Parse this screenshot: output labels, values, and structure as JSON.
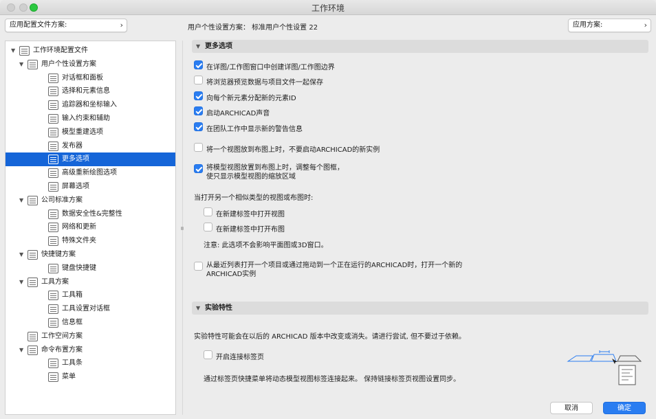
{
  "window": {
    "title": "工作环境"
  },
  "topbar": {
    "profile_select": "应用配置文件方案:",
    "user_scheme": "用户个性设置方案：  标准用户个性设置 22",
    "apply_scheme": "应用方案:"
  },
  "tree": [
    {
      "label": "工作环境配置文件",
      "icon": "monitor-icon",
      "level": 0,
      "expanded": true
    },
    {
      "label": "用户个性设置方案",
      "icon": "user-prefs-icon",
      "level": 1,
      "expanded": true
    },
    {
      "label": "对话框和面板",
      "icon": "dialog-icon",
      "level": 2
    },
    {
      "label": "选择和元素信息",
      "icon": "selection-icon",
      "level": 2
    },
    {
      "label": "追踪器和坐标输入",
      "icon": "xyz-tracker-icon",
      "level": 2
    },
    {
      "label": "输入约束和辅助",
      "icon": "pointer-icon",
      "level": 2
    },
    {
      "label": "模型重建选项",
      "icon": "model-icon",
      "level": 2
    },
    {
      "label": "发布器",
      "icon": "publisher-icon",
      "level": 2
    },
    {
      "label": "更多选项",
      "icon": "more-options-icon",
      "level": 2,
      "selected": true
    },
    {
      "label": "高级重新绘图选项",
      "icon": "redraw-icon",
      "level": 2
    },
    {
      "label": "屏幕选项",
      "icon": "screen-icon",
      "level": 2
    },
    {
      "label": "公司标准方案",
      "icon": "company-icon",
      "level": 1,
      "expanded": true
    },
    {
      "label": "数据安全性&完整性",
      "icon": "data-safety-icon",
      "level": 2
    },
    {
      "label": "网络和更新",
      "icon": "globe-icon",
      "level": 2
    },
    {
      "label": "特殊文件夹",
      "icon": "folder-icon",
      "level": 2
    },
    {
      "label": "快捷键方案",
      "icon": "shortcut-icon",
      "level": 1,
      "expanded": true
    },
    {
      "label": "键盘快捷键",
      "icon": "keyboard-icon",
      "level": 2
    },
    {
      "label": "工具方案",
      "icon": "tools-icon",
      "level": 1,
      "expanded": true
    },
    {
      "label": "工具箱",
      "icon": "toolbox-icon",
      "level": 2
    },
    {
      "label": "工具设置对话框",
      "icon": "tool-settings-icon",
      "level": 2
    },
    {
      "label": "信息框",
      "icon": "info-box-icon",
      "level": 2
    },
    {
      "label": "工作空间方案",
      "icon": "workspace-icon",
      "level": 1
    },
    {
      "label": "命令布置方案",
      "icon": "command-icon",
      "level": 1,
      "expanded": true
    },
    {
      "label": "工具条",
      "icon": "toolbar-icon",
      "level": 2
    },
    {
      "label": "菜单",
      "icon": "menu-icon",
      "level": 2
    }
  ],
  "more_options": {
    "header": "更多选项",
    "opt1": {
      "label": "在详图/工作图窗口中创建详图/工作图边界",
      "checked": true
    },
    "opt2": {
      "label": "将浏览器预览数据与项目文件一起保存",
      "checked": false
    },
    "opt3": {
      "label": "向每个新元素分配新的元素ID",
      "checked": true
    },
    "opt4": {
      "label": "启动ARCHICAD声音",
      "checked": true
    },
    "opt5": {
      "label": "在团队工作中显示新的警告信息",
      "checked": true
    },
    "opt6": {
      "label": "将一个视图放到布图上时，不要启动ARCHICAD的新实例",
      "checked": false
    },
    "opt7": {
      "label": "将模型视图放置到布图上时，调整每个图框，",
      "label2": "使只显示模型视图的缩放区域",
      "checked": true
    },
    "open_similar": "当打开另一个相似类型的视图或布图时:",
    "opt8": {
      "label": "在新建标签中打开视图",
      "checked": false
    },
    "opt9": {
      "label": "在新建标签中打开布图",
      "checked": false
    },
    "note": "注意: 此选项不会影响平面图或3D窗口。",
    "opt10": {
      "label": "从最近列表打开一个项目或通过拖动到一个正在运行的ARCHICAD时，打开一个新的",
      "label2": "ARCHICAD实例",
      "checked": false
    }
  },
  "experimental": {
    "header": "实验特性",
    "desc": "实验特性可能会在以后的 ARCHICAD 版本中改变或消失。请进行尝试, 但不要过于依赖。",
    "opt": {
      "label": "开启连接标签页",
      "checked": false
    },
    "hint": "通过标签页快捷菜单将动态模型视图标签连接起来。 保持链接标签页视图设置同步。"
  },
  "footer": {
    "cancel": "取消",
    "ok": "确定"
  },
  "colors": {
    "accent": "#2a7df1",
    "selection": "#1565d8"
  }
}
